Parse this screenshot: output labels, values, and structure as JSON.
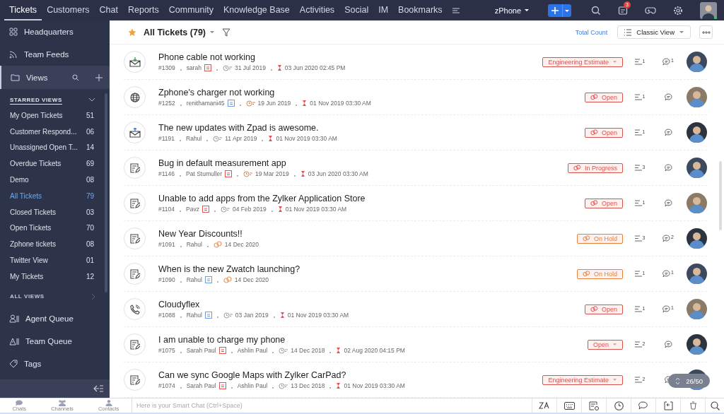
{
  "top_nav": {
    "tabs": [
      {
        "label": "Tickets",
        "selected": true
      },
      {
        "label": "Customers",
        "selected": false
      },
      {
        "label": "Chat",
        "selected": false
      },
      {
        "label": "Reports",
        "selected": false
      },
      {
        "label": "Community",
        "selected": false
      },
      {
        "label": "Knowledge Base",
        "selected": false
      },
      {
        "label": "Activities",
        "selected": false
      },
      {
        "label": "Social",
        "selected": false
      },
      {
        "label": "IM",
        "selected": false
      },
      {
        "label": "Bookmarks",
        "selected": false
      }
    ],
    "department": "zPhone",
    "notification_count": "3"
  },
  "sidebar": {
    "items": [
      {
        "label": "Headquarters",
        "kind": "grid"
      },
      {
        "label": "Team Feeds",
        "kind": "feed"
      }
    ],
    "views_label": "Views",
    "starred_title": "STARRED VIEWS",
    "views": [
      {
        "label": "My Open Tickets",
        "count": "51",
        "selected": false
      },
      {
        "label": "Customer Respond...",
        "count": "06",
        "selected": false
      },
      {
        "label": "Unassigned Open T...",
        "count": "14",
        "selected": false
      },
      {
        "label": "Overdue Tickets",
        "count": "69",
        "selected": false
      },
      {
        "label": "Demo",
        "count": "08",
        "selected": false
      },
      {
        "label": "All Tickets",
        "count": "79",
        "selected": true
      },
      {
        "label": "Closed Tickets",
        "count": "03",
        "selected": false
      },
      {
        "label": "Open Tickets",
        "count": "70",
        "selected": false
      },
      {
        "label": "Zphone tickets",
        "count": "08",
        "selected": false
      },
      {
        "label": "Twitter View",
        "count": "01",
        "selected": false
      },
      {
        "label": "My Tickets",
        "count": "12",
        "selected": false
      }
    ],
    "all_views": "ALL VIEWS",
    "bottom_items": [
      {
        "label": "Agent Queue",
        "kind": "agent"
      },
      {
        "label": "Team Queue",
        "kind": "team"
      },
      {
        "label": "Tags",
        "kind": "tag"
      }
    ],
    "dock": [
      "Chats",
      "Channels",
      "Contacts"
    ]
  },
  "header": {
    "title": "All Tickets (79)",
    "total_count": "Total Count",
    "view_mode": "Classic View"
  },
  "tickets": [
    {
      "kind": "email_in",
      "subject": "Phone cable not working",
      "id": "#1309",
      "contact": {
        "name": "sarah",
        "color": "#e05656"
      },
      "created": {
        "kind": "clock",
        "overdue": false,
        "date": "31 Jul 2019"
      },
      "due": "03 Jun 2020 02:45 PM",
      "status": {
        "label": "Engineering Estimate",
        "color": "#d9534f",
        "menu": true
      },
      "threads": "1",
      "comments": "1"
    },
    {
      "kind": "web",
      "subject": "Zphone's charger not working",
      "id": "#1252",
      "contact": {
        "name": "renithamani45",
        "color": "#6a9be6"
      },
      "created": {
        "kind": "clock",
        "overdue": true,
        "date": "19 Jun 2019"
      },
      "due": "01 Nov 2019 03:30 AM",
      "status": {
        "label": "Open",
        "color": "#d9534f",
        "menu": false
      },
      "threads": "1"
    },
    {
      "kind": "email_out",
      "subject": "The new updates with Zpad is awesome.",
      "id": "#1191",
      "contact": {
        "name": "Rahul"
      },
      "created": {
        "kind": "clock",
        "overdue": false,
        "date": "11 Apr 2019"
      },
      "due": "01 Nov 2019 03:30 AM",
      "status": {
        "label": "Open",
        "color": "#d9534f",
        "menu": false
      },
      "threads": "1"
    },
    {
      "kind": "form",
      "subject": "Bug in default measurement app",
      "id": "#1146",
      "contact": {
        "name": "Pat Stumuller",
        "color": "#e05656"
      },
      "created": {
        "kind": "clock",
        "overdue": true,
        "date": "19 Mar 2019"
      },
      "due": "03 Jun 2020 03:30 AM",
      "status": {
        "label": "In Progress",
        "color": "#d9534f",
        "menu": false
      },
      "threads": "3"
    },
    {
      "kind": "form",
      "subject": "Unable to add apps from the Zylker Application Store",
      "id": "#1104",
      "contact": {
        "name": "Pavz",
        "color": "#e05656"
      },
      "created": {
        "kind": "clock",
        "overdue": false,
        "date": "04 Feb 2019"
      },
      "due": "01 Nov 2019 03:30 AM",
      "status": {
        "label": "Open",
        "color": "#d9534f",
        "menu": false
      },
      "threads": "1"
    },
    {
      "kind": "form",
      "subject": "New Year Discounts!!",
      "id": "#1091",
      "contact": {
        "name": "Rahul"
      },
      "created": {
        "kind": "hold",
        "date": "14 Dec 2020"
      },
      "status": {
        "label": "On Hold",
        "color": "#e8803a",
        "menu": false
      },
      "threads": "3",
      "comments": "2"
    },
    {
      "kind": "form",
      "subject": "When is the new Zwatch launching?",
      "id": "#1090",
      "contact": {
        "name": "Rahul",
        "color": "#6a9be6"
      },
      "created": {
        "kind": "hold",
        "date": "14 Dec 2020"
      },
      "status": {
        "label": "On Hold",
        "color": "#e8803a",
        "menu": false
      },
      "threads": "1",
      "comments": "1"
    },
    {
      "kind": "phone",
      "subject": "Cloudyflex",
      "id": "#1088",
      "contact": {
        "name": "Rahul",
        "color": "#6a9be6"
      },
      "created": {
        "kind": "clock",
        "overdue": false,
        "date": "03 Jan 2019"
      },
      "due": "01 Nov 2019 03:30 AM",
      "status": {
        "label": "Open",
        "color": "#d9534f",
        "menu": false
      },
      "threads": "1",
      "comments": "1"
    },
    {
      "kind": "form",
      "subject": "I am unable to charge my phone",
      "id": "#1075",
      "contact": {
        "name": "Sarah Paul",
        "color": "#e05656"
      },
      "account": "Ashlin Paul",
      "created": {
        "kind": "clock",
        "overdue": false,
        "date": "14 Dec 2018"
      },
      "due": "02 Aug 2020 04:15 PM",
      "status": {
        "label": "Open",
        "color": "#d9534f",
        "menu": true
      },
      "threads": "2"
    },
    {
      "kind": "form",
      "subject": "Can we sync Google Maps with Zylker CarPad?",
      "id": "#1074",
      "contact": {
        "name": "Sarah Paul",
        "color": "#e05656"
      },
      "account": "Ashlin Paul",
      "created": {
        "kind": "clock",
        "overdue": false,
        "date": "13 Dec 2018"
      },
      "due": "01 Nov 2019 03:30 AM",
      "status": {
        "label": "Engineering Estimate",
        "color": "#d9534f",
        "menu": true
      },
      "threads": "2"
    }
  ],
  "pager": "26/50",
  "smart_chat": {
    "placeholder": "Here is your Smart Chat (Ctrl+Space)"
  }
}
